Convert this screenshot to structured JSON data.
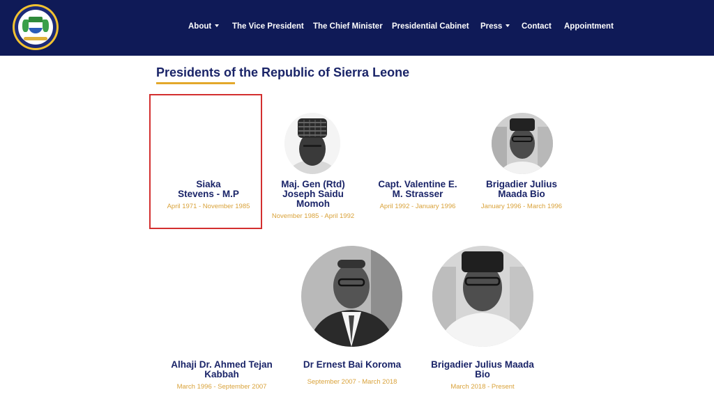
{
  "header": {
    "nav": [
      {
        "label": "About",
        "dropdown": true
      },
      {
        "label": "The Vice President",
        "dropdown": false
      },
      {
        "label": "The Chief Minister",
        "dropdown": false
      },
      {
        "label": "Presidential Cabinet",
        "dropdown": false
      },
      {
        "label": "Press",
        "dropdown": true
      },
      {
        "label": "Contact",
        "dropdown": false
      },
      {
        "label": "Appointment",
        "dropdown": false
      }
    ],
    "colors": {
      "background": "#0f1a57",
      "text": "#ffffff"
    }
  },
  "main": {
    "title": "Presidents of the Republic of Sierra Leone",
    "accent": "#e3a82b",
    "presidents": [
      {
        "name_lines": [
          "Siaka",
          "Stevens - M.P"
        ],
        "dates": "April 1971 - November 1985",
        "photo": "none"
      },
      {
        "name_lines": [
          "Maj. Gen (Rtd)",
          "Joseph Saidu",
          "Momoh"
        ],
        "dates": "November 1985 - April 1992",
        "photo": "portrait"
      },
      {
        "name_lines": [
          "Capt. Valentine E.",
          "M. Strasser"
        ],
        "dates": "April 1992 - January 1996",
        "photo": "none"
      },
      {
        "name_lines": [
          "Brigadier Julius",
          "Maada Bio"
        ],
        "dates": "January 1996 - March 1996",
        "photo": "portrait"
      },
      {
        "name_lines": [
          "Alhaji Dr. Ahmed Tejan",
          "Kabbah"
        ],
        "dates": "March 1996 - September 2007",
        "photo": "none"
      },
      {
        "name_lines": [
          "Dr Ernest Bai Koroma"
        ],
        "dates": "September 2007 - March 2018",
        "photo": "portrait"
      },
      {
        "name_lines": [
          "Brigadier Julius Maada",
          "Bio"
        ],
        "dates": "March 2018 - Present",
        "photo": "portrait"
      }
    ]
  }
}
